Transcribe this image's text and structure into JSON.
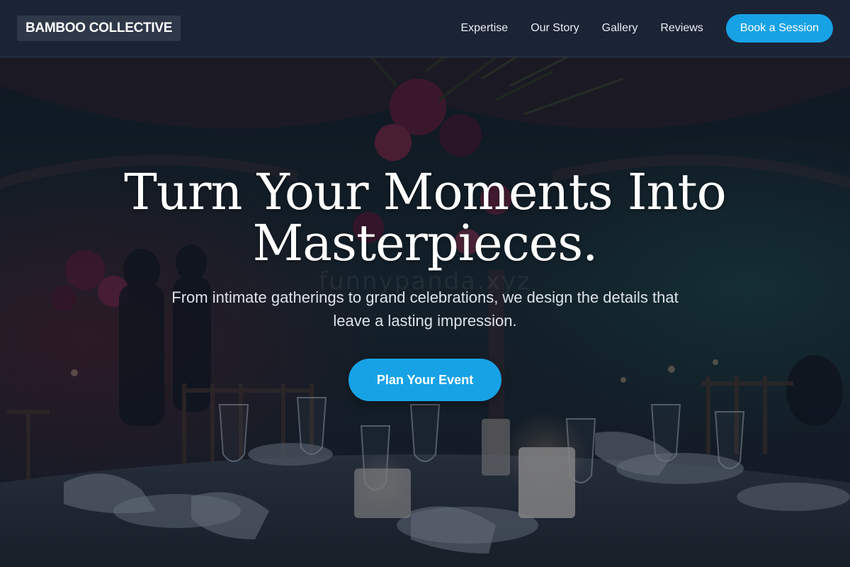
{
  "header": {
    "logo": "BAMBOO COLLECTIVE",
    "nav": [
      {
        "label": "Expertise"
      },
      {
        "label": "Our Story"
      },
      {
        "label": "Gallery"
      },
      {
        "label": "Reviews"
      }
    ],
    "cta": "Book a Session"
  },
  "hero": {
    "title_line1": "Turn Your Moments Into",
    "title_line2": "Masterpieces.",
    "subtitle_line1": "From intimate gatherings to grand celebrations, we design the details that",
    "subtitle_line2": "leave a lasting impression.",
    "cta": "Plan Your Event",
    "watermark": "funnypanda.xyz"
  },
  "colors": {
    "accent": "#17a2e6",
    "header_bg": "#1b2435",
    "logo_bg": "#2e3849"
  }
}
